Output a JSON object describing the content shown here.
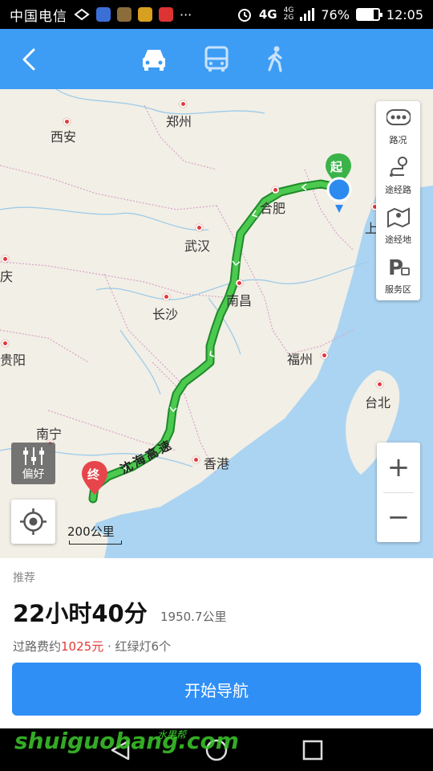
{
  "status_bar": {
    "carrier": "中国电信",
    "network": "4G",
    "network_small": "4G",
    "network_small2": "2G",
    "battery": "76%",
    "time": "12:05"
  },
  "header": {
    "modes": [
      "car-icon",
      "bus-icon",
      "walk-icon"
    ],
    "active_mode": "car"
  },
  "map": {
    "cities": {
      "xian": "西安",
      "zhengzhou": "郑州",
      "hefei": "合肥",
      "wuhan": "武汉",
      "nanchang": "南昌",
      "changsha": "长沙",
      "fuzhou": "福州",
      "taipei": "台北",
      "hongkong": "香港",
      "nanning": "南宁",
      "guiyang": "贵阳",
      "chongqing": "庆",
      "shanghai": "上"
    },
    "road_label": "沈海高速",
    "start_marker": "起",
    "end_marker": "终",
    "scale": "200公里",
    "side_buttons": {
      "traffic": "路况",
      "waypoint": "途经路",
      "via_place": "途经地",
      "service": "服务区"
    },
    "preference": "偏好",
    "zoom_in": "+",
    "zoom_out": "−"
  },
  "route": {
    "recommend": "推荐",
    "duration": "22小时40分",
    "distance": "1950.7公里",
    "toll_prefix": "过路费约",
    "toll_amount": "1025元",
    "lights": "· 红绿灯6个",
    "start_button": "开始导航"
  },
  "watermark": {
    "text": "shuiguobang.com",
    "sub": "水果帮"
  },
  "colors": {
    "header": "#3d9df5",
    "button": "#2f8ff5",
    "route": "#34b34a",
    "toll": "#e53935"
  }
}
